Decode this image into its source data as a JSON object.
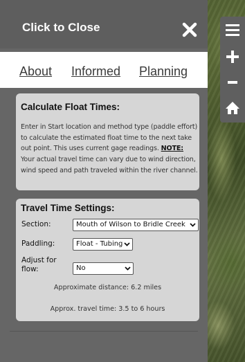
{
  "panel": {
    "header_title": "Click to Close",
    "tabs": [
      {
        "label": "About"
      },
      {
        "label": "Informed"
      },
      {
        "label": "Planning"
      }
    ]
  },
  "calculate": {
    "title": "Calculate Float Times:",
    "description": "Enter in Start location and method type (paddle effort) to calculate the estimated float time to the next take out point. This uses current gage readings.",
    "note_label": "NOTE:",
    "note_text": "Your actual travel time can vary due to wind direction, wind speed and path traveled within the river channel."
  },
  "settings": {
    "title": "Travel Time Settings:",
    "section_label": "Section:",
    "section_value": "Mouth of Wilson to Bridle Creek",
    "paddling_label": "Paddling:",
    "paddling_value": "Float - Tubing",
    "adjust_label": "Adjust for flow:",
    "adjust_value": "No",
    "distance_text": "Approximate distance: 6.2 miles",
    "time_text": "Approx. travel time: 3.5 to 6 hours"
  },
  "map_controls": {
    "icons": [
      "menu-icon",
      "zoom-in-icon",
      "zoom-out-icon",
      "home-icon"
    ]
  }
}
